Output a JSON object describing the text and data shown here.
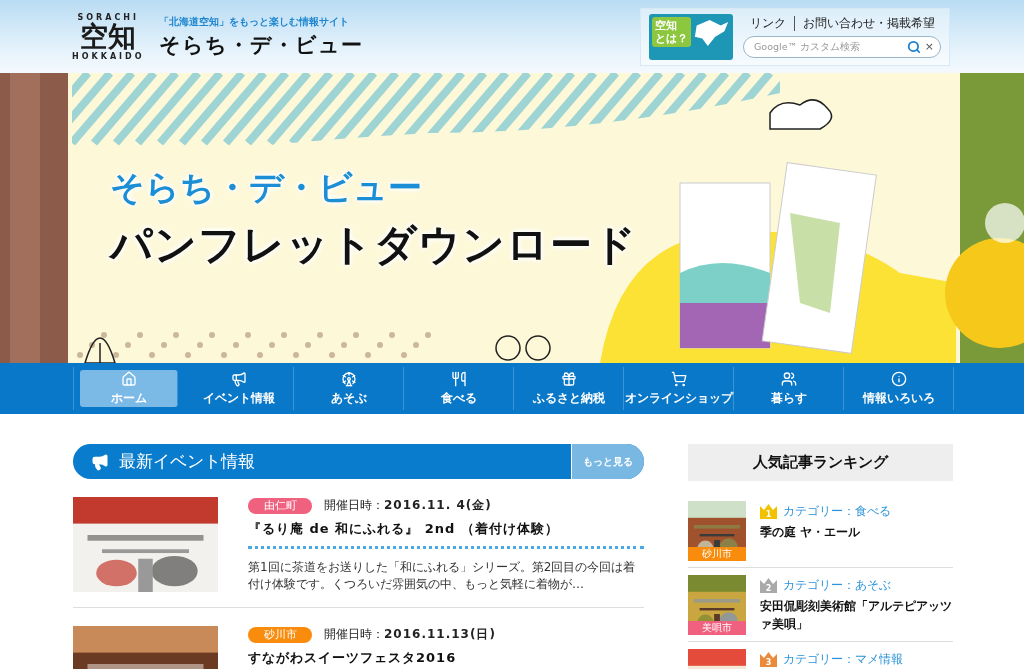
{
  "header": {
    "logo": {
      "top": "SORACHI",
      "main": "空知",
      "bottom": "HOKKAIDO"
    },
    "tagline": "「北海道空知」をもっと楽しむ情報サイト",
    "site_name": "そらち・デ・ビュー",
    "about_badge": [
      "空知",
      "とは？"
    ],
    "links": [
      "リンク",
      "お問い合わせ・掲載希望"
    ],
    "search": {
      "placeholder": "Google™ カスタム検索",
      "clear": "×"
    }
  },
  "banner": {
    "subtitle": "そらち・デ・ビュー",
    "title": "パンフレットダウンロード"
  },
  "nav": [
    {
      "label": "ホーム",
      "kind": "home",
      "selected": true
    },
    {
      "label": "イベント情報",
      "kind": "megaphone",
      "selected": false
    },
    {
      "label": "あそぶ",
      "kind": "wheel",
      "selected": false
    },
    {
      "label": "食べる",
      "kind": "food",
      "selected": false
    },
    {
      "label": "ふるさと納税",
      "kind": "gift",
      "selected": false
    },
    {
      "label": "オンラインショップ",
      "kind": "cart",
      "selected": false
    },
    {
      "label": "暮らす",
      "kind": "family",
      "selected": false
    },
    {
      "label": "情報いろいろ",
      "kind": "info",
      "selected": false
    }
  ],
  "events": {
    "title": "最新イベント情報",
    "more": "もっと見る",
    "items": [
      {
        "area": "由仁町",
        "color": "#f0607f",
        "date_label": "開催日時：",
        "date": "2016.11. 4(金)",
        "title": "『るり庵 de 和にふれる』 2nd （着付け体験）",
        "summary": "第1回に茶道をお送りした「和にふれる」シリーズ。第2回目の今回は着付け体験です。くつろいだ雰囲気の中、もっと気軽に着物が…"
      },
      {
        "area": "砂川市",
        "color": "#f98c0c",
        "date_label": "開催日時：",
        "date": "2016.11.13(日)",
        "title": "すながわスイーツフェスタ2016"
      }
    ]
  },
  "ranking": {
    "title": "人気記事ランキング",
    "items": [
      {
        "rank": {
          "label": "1",
          "color": "#f2c200"
        },
        "category": "カテゴリー：食べる",
        "title": "季の庭 ヤ・エール",
        "area": {
          "label": "砂川市",
          "color": "#f98c0c"
        }
      },
      {
        "rank": {
          "label": "2",
          "color": "#a9a9a9"
        },
        "category": "カテゴリー：あそぶ",
        "title": "安田侃彫刻美術館「アルテピアッツァ美唄」",
        "area": {
          "label": "美唄市",
          "color": "#f0607f"
        }
      },
      {
        "rank": {
          "label": "3",
          "color": "#ec8a3c"
        },
        "category": "カテゴリー：マメ情報"
      }
    ]
  }
}
